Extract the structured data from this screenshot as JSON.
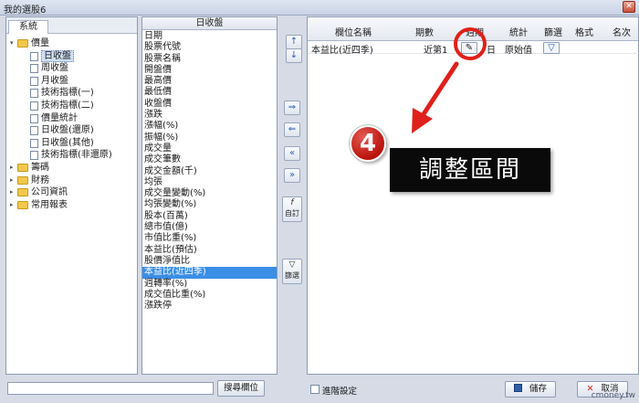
{
  "window": {
    "title": "我的選股6",
    "close_label": "✕"
  },
  "tree": {
    "tab": "系統",
    "root_open": "價量",
    "children": [
      "日收盤",
      "周收盤",
      "月收盤",
      "技術指標(一)",
      "技術指標(二)",
      "價量統計",
      "日收盤(還原)",
      "日收盤(其他)",
      "技術指標(非還原)"
    ],
    "closed": [
      "籌碼",
      "財務",
      "公司資訊",
      "常用報表"
    ],
    "open_toggle": "▾",
    "closed_toggle": "▸"
  },
  "fields": {
    "header": "日收盤",
    "items": [
      "日期",
      "股票代號",
      "股票名稱",
      "開盤價",
      "最高價",
      "最低價",
      "收盤價",
      "漲跌",
      "漲幅(%)",
      "振幅(%)",
      "成交量",
      "成交筆數",
      "成交金額(千)",
      "均張",
      "成交量變動(%)",
      "均張變動(%)",
      "股本(百萬)",
      "總市值(億)",
      "市值比重(%)",
      "本益比(預估)",
      "股價淨值比",
      "本益比(近四季)",
      "週轉率(%)",
      "成交值比重(%)",
      "漲跌停"
    ],
    "selected_index": 21
  },
  "mid_buttons": {
    "up": "↑",
    "down": "↓",
    "add": "⇒",
    "remove": "⇐",
    "remove_all": "«",
    "add_all": "»",
    "custom_icon": "f",
    "custom_label": "自訂",
    "filter_icon": "▽",
    "filter_label": "篩選"
  },
  "grid": {
    "columns": [
      "欄位名稱",
      "期數",
      "週期",
      "統計",
      "篩選",
      "格式",
      "名次"
    ],
    "row": {
      "name": "本益比(近四季)",
      "period": "近第1",
      "cycle": "日",
      "stat": "原始值",
      "edit_icon": "✎",
      "filter_icon": "▽"
    }
  },
  "callout": {
    "number": "4",
    "text": "調整區間"
  },
  "bottom": {
    "search_value": "",
    "search_button": "搜尋欄位",
    "advanced_label": "進階設定",
    "save_label": "儲存",
    "cancel_label": "取消",
    "watermark": "cmoney.tw"
  }
}
